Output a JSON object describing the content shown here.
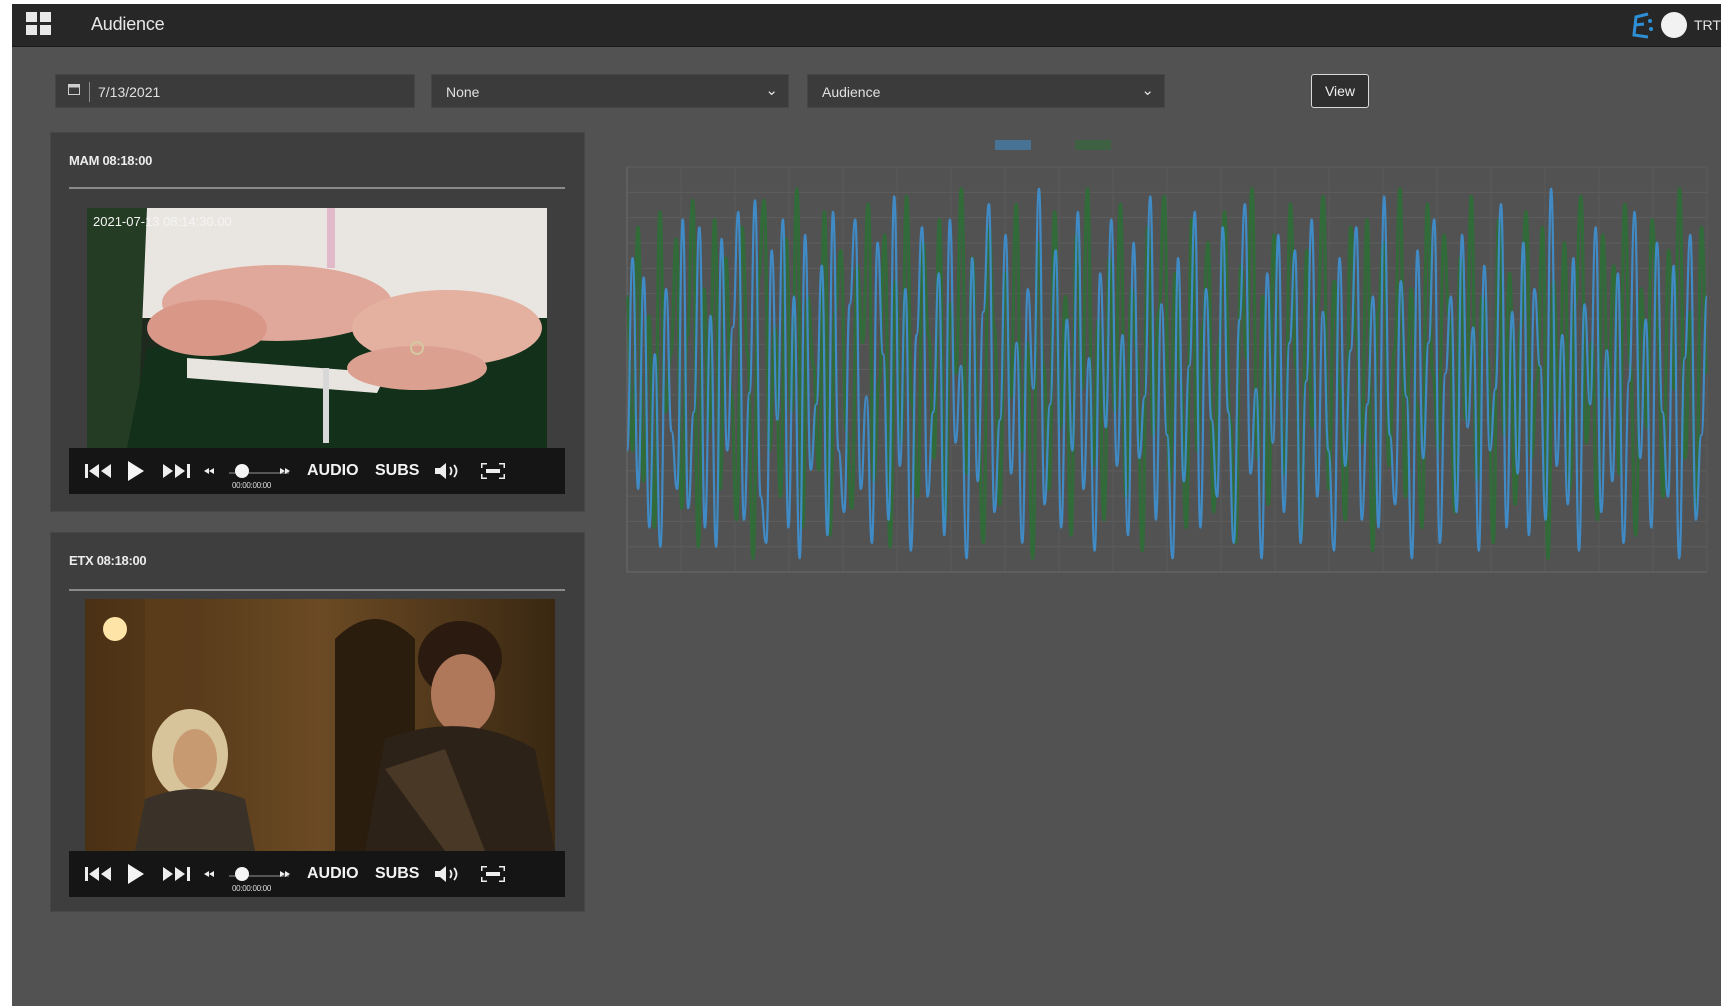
{
  "header": {
    "title": "Audience",
    "user": "TRT"
  },
  "filters": {
    "date": "7/13/2021",
    "select1": "None",
    "select2": "Audience",
    "view_label": "View"
  },
  "players": [
    {
      "title": "MAM 08:18:00",
      "overlay_timestamp": "2021-07-13 08:14:30.00",
      "audio_label": "AUDIO",
      "subs_label": "SUBS",
      "time_display": "00:00:00:00"
    },
    {
      "title": "ETX 08:18:00",
      "audio_label": "AUDIO",
      "subs_label": "SUBS",
      "time_display": "00:00:00:00"
    }
  ],
  "colors": {
    "series_blue": "#3f8ecb",
    "series_green": "#2e6e36",
    "background": "#525252",
    "header": "#272727"
  },
  "icons": [
    "grid-icon",
    "calendar-icon",
    "chevron-down-icon",
    "skip-back-icon",
    "play-icon",
    "skip-forward-icon",
    "volume-icon",
    "fullscreen-icon"
  ],
  "chart_data": {
    "type": "line",
    "grid": true,
    "legend": "top-center",
    "n_points": 200,
    "series": [
      {
        "color": "#2e6e36",
        "values": [
          0.7,
          0.3,
          0.88,
          0.22,
          0.65,
          0.1,
          0.92,
          0.4,
          0.55,
          0.85,
          0.15,
          0.6,
          0.95,
          0.05,
          0.72,
          0.35,
          0.9,
          0.2,
          0.8,
          0.45,
          0.12,
          0.88,
          0.55,
          0.02,
          0.75,
          0.95,
          0.3,
          0.62,
          0.18,
          0.85,
          0.4,
          0.98,
          0.1,
          0.7,
          0.52,
          0.25,
          0.92,
          0.08,
          0.66,
          0.82,
          0.35,
          0.15,
          0.78,
          0.58,
          0.94,
          0.22,
          0.48,
          0.86,
          0.05,
          0.74,
          0.32,
          0.96,
          0.42,
          0.18,
          0.84,
          0.6,
          0.28,
          0.9,
          0.12,
          0.68,
          0.5,
          0.98,
          0.24,
          0.8,
          0.38,
          0.06,
          0.88,
          0.62,
          0.16,
          0.76,
          0.44,
          0.94,
          0.3,
          0.58,
          0.02,
          0.84,
          0.52,
          0.2,
          0.92,
          0.36,
          0.7,
          0.08,
          0.86,
          0.46,
          0.98,
          0.26,
          0.64,
          0.12,
          0.8,
          0.4,
          0.94,
          0.18,
          0.72,
          0.56,
          0.04,
          0.88,
          0.34,
          0.66,
          0.96,
          0.22,
          0.76,
          0.48,
          0.1,
          0.9,
          0.3,
          0.62,
          0.84,
          0.14,
          0.58,
          0.92,
          0.38,
          0.06,
          0.78,
          0.54,
          0.98,
          0.28,
          0.7,
          0.16,
          0.86,
          0.44,
          0.24,
          0.94,
          0.52,
          0.08,
          0.82,
          0.36,
          0.68,
          0.96,
          0.2,
          0.74,
          0.46,
          0.12,
          0.88,
          0.6,
          0.32,
          0.9,
          0.04,
          0.66,
          0.84,
          0.26,
          0.56,
          0.98,
          0.18,
          0.72,
          0.42,
          0.1,
          0.94,
          0.5,
          0.3,
          0.86,
          0.64,
          0.14,
          0.8,
          0.38,
          0.96,
          0.22,
          0.7,
          0.54,
          0.06,
          0.9,
          0.34,
          0.76,
          0.16,
          0.62,
          0.92,
          0.28,
          0.48,
          0.88,
          0.02,
          0.74,
          0.4,
          0.84,
          0.2,
          0.68,
          0.96,
          0.32,
          0.58,
          0.12,
          0.86,
          0.44,
          0.78,
          0.24,
          0.94,
          0.52,
          0.08,
          0.72,
          0.36,
          0.9,
          0.6,
          0.18,
          0.82,
          0.46,
          0.98,
          0.28,
          0.66,
          0.14,
          0.88,
          0.5
        ]
      },
      {
        "color": "#3f8ecb",
        "values": [
          0.3,
          0.8,
          0.2,
          0.75,
          0.1,
          0.55,
          0.05,
          0.72,
          0.35,
          0.2,
          0.9,
          0.15,
          0.4,
          0.88,
          0.1,
          0.65,
          0.05,
          0.85,
          0.3,
          0.62,
          0.92,
          0.12,
          0.45,
          0.95,
          0.18,
          0.06,
          0.82,
          0.38,
          0.9,
          0.1,
          0.7,
          0.02,
          0.86,
          0.25,
          0.42,
          0.78,
          0.08,
          0.92,
          0.3,
          0.14,
          0.68,
          0.9,
          0.2,
          0.44,
          0.06,
          0.84,
          0.55,
          0.12,
          0.96,
          0.26,
          0.72,
          0.04,
          0.6,
          0.88,
          0.18,
          0.4,
          0.76,
          0.08,
          0.9,
          0.32,
          0.52,
          0.02,
          0.8,
          0.22,
          0.66,
          0.94,
          0.14,
          0.38,
          0.86,
          0.24,
          0.58,
          0.06,
          0.72,
          0.46,
          0.98,
          0.16,
          0.42,
          0.82,
          0.1,
          0.64,
          0.3,
          0.92,
          0.2,
          0.54,
          0.04,
          0.76,
          0.36,
          0.9,
          0.26,
          0.6,
          0.08,
          0.84,
          0.28,
          0.44,
          0.96,
          0.12,
          0.68,
          0.34,
          0.02,
          0.8,
          0.22,
          0.52,
          0.92,
          0.1,
          0.72,
          0.38,
          0.18,
          0.88,
          0.4,
          0.06,
          0.64,
          0.94,
          0.24,
          0.46,
          0.02,
          0.76,
          0.32,
          0.86,
          0.14,
          0.58,
          0.82,
          0.06,
          0.48,
          0.9,
          0.18,
          0.66,
          0.3,
          0.04,
          0.8,
          0.26,
          0.56,
          0.88,
          0.12,
          0.42,
          0.7,
          0.1,
          0.96,
          0.34,
          0.16,
          0.74,
          0.44,
          0.02,
          0.82,
          0.28,
          0.58,
          0.9,
          0.06,
          0.5,
          0.7,
          0.14,
          0.86,
          0.36,
          0.62,
          0.04,
          0.78,
          0.3,
          0.46,
          0.94,
          0.1,
          0.66,
          0.24,
          0.84,
          0.08,
          0.72,
          0.52,
          0.12,
          0.98,
          0.26,
          0.6,
          0.16,
          0.8,
          0.04,
          0.68,
          0.42,
          0.88,
          0.14,
          0.56,
          0.22,
          0.76,
          0.06,
          0.48,
          0.92,
          0.28,
          0.64,
          0.1,
          0.84,
          0.4,
          0.18,
          0.78,
          0.02,
          0.54,
          0.86,
          0.12,
          0.34,
          0.7
        ]
      }
    ]
  }
}
